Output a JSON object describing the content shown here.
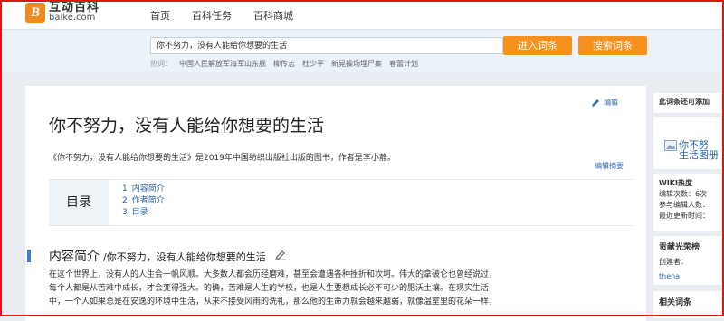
{
  "logo": {
    "mark": "B",
    "name_cn": "互动百科",
    "name_en": "baike.com"
  },
  "nav": {
    "items": [
      "首页",
      "百科任务",
      "百科商城"
    ]
  },
  "search": {
    "value": "你不努力，没有人能给你想要的生活",
    "enter_label": "进入词条",
    "search_label": "搜索词条",
    "hot_label": "热词：",
    "hot_terms": [
      "中国人民解放军海军山东舰",
      "柳传志",
      "杜少平",
      "新晃操场埋尸案",
      "春蕾计划"
    ]
  },
  "article": {
    "edit_label": "编辑",
    "title": "你不努力，没有人能给你想要的生活",
    "summary": "《你不努力，没有人能给你想要的生活》是2019年中国纺织出版社出版的图书，作者是李小静。",
    "edit_summary_label": "编辑摘要",
    "toc": {
      "title": "目录",
      "items": [
        {
          "num": "1",
          "label": "内容简介"
        },
        {
          "num": "2",
          "label": "作者简介"
        },
        {
          "num": "3",
          "label": "目录"
        }
      ]
    },
    "section": {
      "title": "内容简介",
      "subtitle": "/你不努力，没有人能给你想要的生活"
    },
    "body": [
      "在这个世界上，没有人的人生会一帆风顺。大多数人都会历经磨难，甚至会遭遇各种挫折和坎坷。伟大的拿破仑也曾经说过，",
      "每个人都是从苦难中成长，才会变得强大。的确，苦难是人生的学校，也是人生要想成长必不可少的肥沃土壤。在现实生活",
      "中，一个人如果总是在安逸的环境中生活，从来不接受风雨的洗礼，那么他的生命力就会越来越弱，就像温室里的花朵一样，"
    ]
  },
  "sidebar": {
    "box1": "此词条还可添加",
    "box2_text": [
      "你不努",
      "生活图册"
    ],
    "wiki": {
      "heading": "WIKI热度",
      "lines": [
        "编辑次数：6次",
        "参与编辑人数：",
        "最近更新时间："
      ]
    },
    "contrib": {
      "heading": "贡献光荣榜",
      "creator": "创建者：",
      "user": "thena"
    },
    "related": "相关词条"
  },
  "colors": {
    "accent": "#f7911e",
    "link": "#2b63a8",
    "frame": "#e01414",
    "toc_bg": "#eef3f8"
  }
}
